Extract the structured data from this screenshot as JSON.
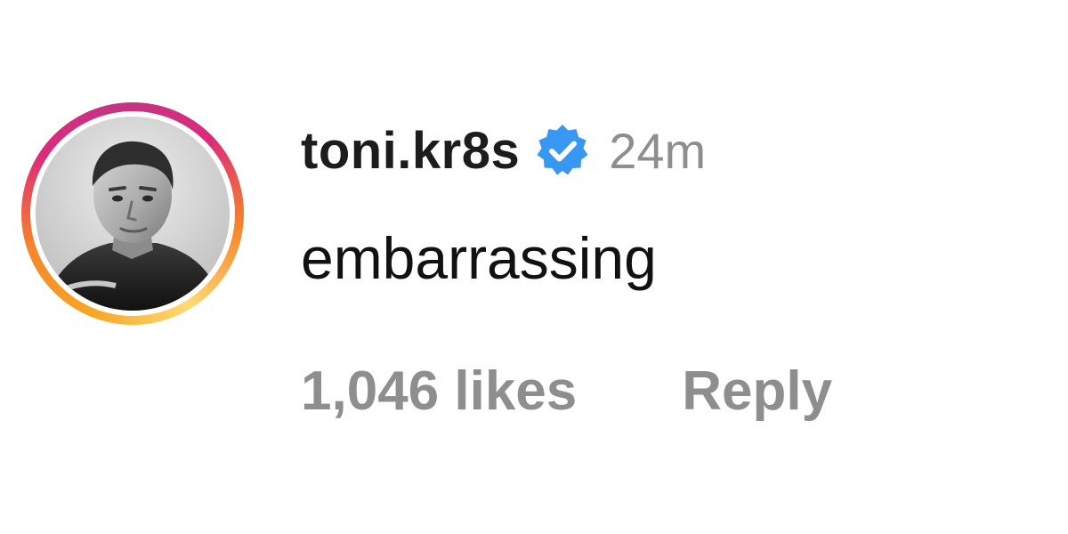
{
  "comment": {
    "username": "toni.kr8s",
    "verified_icon": "verified-badge-icon",
    "time": "24m",
    "text": "embarrassing",
    "likes": "1,046 likes",
    "reply_label": "Reply"
  },
  "avatar": {
    "ring_colors": [
      "#feda75",
      "#f58529",
      "#dd2a7b",
      "#c13584"
    ],
    "style": "grayscale portrait"
  },
  "colors": {
    "verified": "#3897f0",
    "muted": "#8e8e8e",
    "text": "#111111"
  }
}
